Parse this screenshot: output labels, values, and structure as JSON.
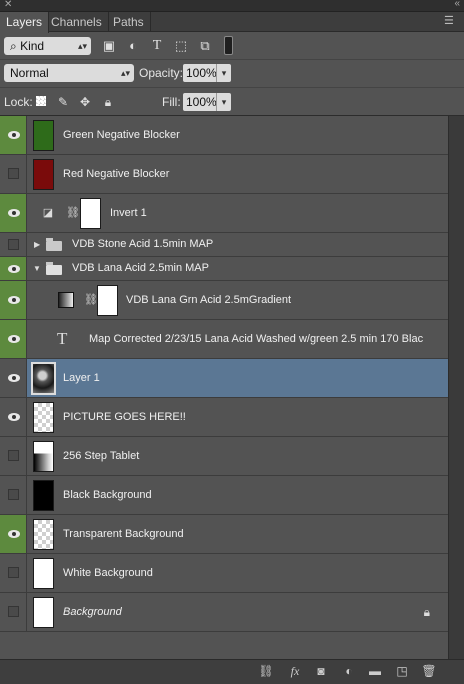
{
  "tabs": [
    "Layers",
    "Channels",
    "Paths"
  ],
  "filter": {
    "kind_label": "Kind",
    "icons": [
      "pixel-filter-icon",
      "adjustment-filter-icon",
      "type-filter-icon",
      "shape-filter-icon",
      "smart-object-filter-icon"
    ]
  },
  "blend": {
    "mode": "Normal",
    "opacity_label": "Opacity:",
    "opacity": "100%",
    "fill_label": "Fill:",
    "fill": "100%"
  },
  "lock": {
    "label": "Lock:",
    "icons": [
      "lock-transparency-icon",
      "lock-image-icon",
      "lock-position-icon",
      "lock-all-icon"
    ]
  },
  "layers": [
    {
      "name": "Green Negative Blocker",
      "visible": true,
      "thumb": "solid",
      "color": "#2e6b1a"
    },
    {
      "name": "Red Negative Blocker",
      "visible": false,
      "thumb": "solid",
      "color": "#7a0b0b"
    },
    {
      "name": "Invert 1",
      "visible": true,
      "thumb": "adjustment"
    },
    {
      "name": "VDB Stone Acid 1.5min MAP",
      "visible": false,
      "thumb": "group-closed"
    },
    {
      "name": "VDB Lana Acid 2.5min MAP",
      "visible": true,
      "thumb": "group-open"
    },
    {
      "name": "VDB Lana Grn Acid  2.5mGradient",
      "visible": true,
      "thumb": "gradient"
    },
    {
      "name": "Map Corrected 2/23/15 Lana Acid Washed w/green 2.5 min 170 Blac",
      "visible": true,
      "thumb": "text"
    },
    {
      "name": "Layer 1",
      "visible": true,
      "thumb": "photo",
      "selected": true
    },
    {
      "name": "PICTURE GOES HERE!!",
      "visible": true,
      "thumb": "checker"
    },
    {
      "name": "256 Step Tablet",
      "visible": false,
      "thumb": "steps"
    },
    {
      "name": "Black Background",
      "visible": false,
      "thumb": "solid",
      "color": "#000000"
    },
    {
      "name": "Transparent Background",
      "visible": true,
      "thumb": "checker"
    },
    {
      "name": "White Background",
      "visible": false,
      "thumb": "solid",
      "color": "#ffffff"
    },
    {
      "name": "Background",
      "visible": false,
      "thumb": "solid",
      "color": "#ffffff",
      "italic": true,
      "locked": true
    }
  ],
  "footer_icons": [
    "link-layers-icon",
    "fx-icon",
    "add-mask-icon",
    "new-adjustment-icon",
    "new-group-icon",
    "new-layer-icon",
    "trash-icon"
  ],
  "colors": {
    "visible_green": "#5d8a3e",
    "selected_blue": "#5b7794",
    "panel": "#535353"
  }
}
